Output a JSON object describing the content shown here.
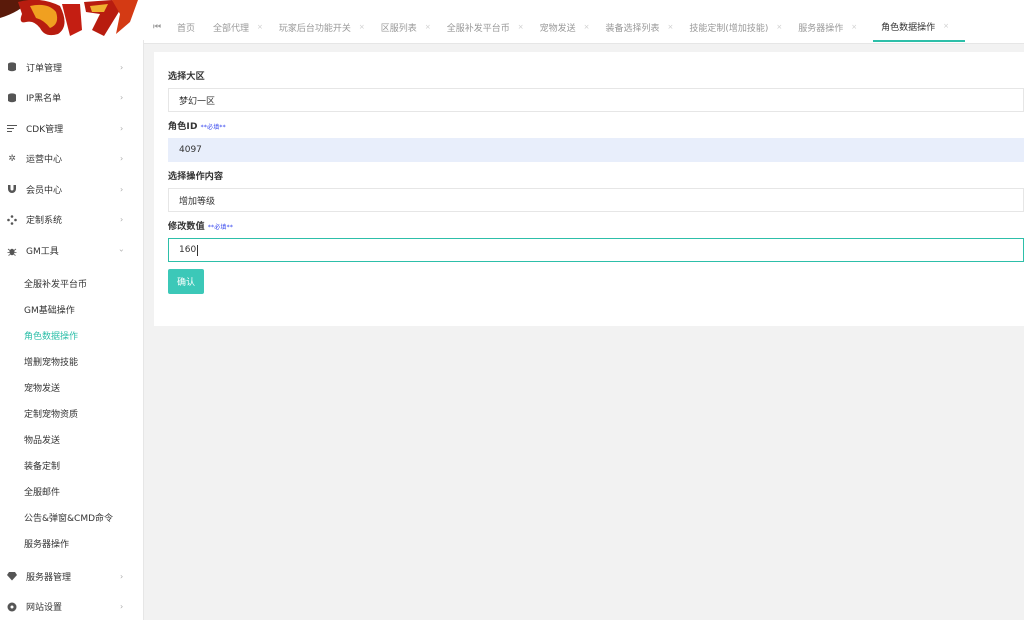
{
  "sidebar": {
    "menu": [
      {
        "icon": "database-icon",
        "label": "订单管理"
      },
      {
        "icon": "database-icon",
        "label": "IP黑名单"
      },
      {
        "icon": "list-icon",
        "label": "CDK管理"
      },
      {
        "icon": "gear-icon",
        "label": "运营中心"
      },
      {
        "icon": "magnet-icon",
        "label": "会员中心"
      },
      {
        "icon": "dpad-icon",
        "label": "定制系统"
      },
      {
        "icon": "bug-icon",
        "label": "GM工具"
      }
    ],
    "submenu": [
      "全服补发平台币",
      "GM基础操作",
      "角色数据操作",
      "增删宠物技能",
      "宠物发送",
      "定制宠物资质",
      "物品发送",
      "装备定制",
      "全服邮件",
      "公告&弹窗&CMD命令",
      "服务器操作"
    ],
    "menu_after": [
      {
        "icon": "diamond-icon",
        "label": "服务器管理"
      },
      {
        "icon": "settings-circle-icon",
        "label": "网站设置"
      }
    ]
  },
  "tabs": [
    "首页",
    "全部代理",
    "玩家后台功能开关",
    "区服列表",
    "全服补发平台币",
    "宠物发送",
    "装备选择列表",
    "技能定制(增加技能)",
    "服务器操作",
    "角色数据操作"
  ],
  "form": {
    "region_label": "选择大区",
    "region_value": "梦幻一区",
    "role_id_label": "角色ID",
    "required_note": "**必填**",
    "role_id_value": "4097",
    "operation_label": "选择操作内容",
    "operation_value": "增加等级",
    "modify_label": "修改数值",
    "modify_value": "160",
    "confirm_label": "确认"
  },
  "colors": {
    "accent": "#2dbfa9",
    "button": "#3cc8b8",
    "required": "#3344ee"
  }
}
